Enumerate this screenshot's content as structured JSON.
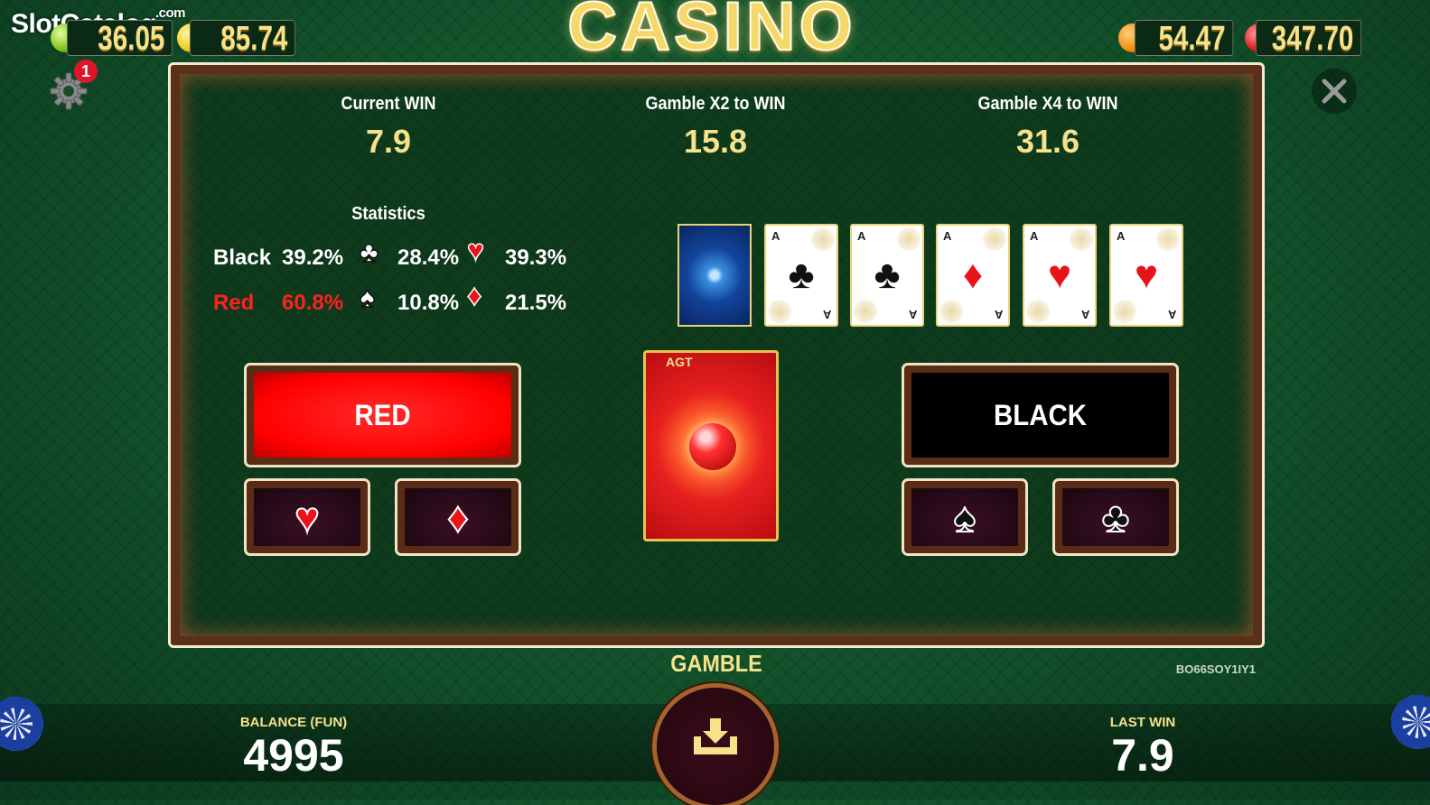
{
  "watermark": {
    "text": "SlotCatalog",
    "suffix": ".com"
  },
  "top_counters": {
    "left1": {
      "icon": "lime-icon",
      "value": "36.05"
    },
    "left2": {
      "icon": "lemon-icon",
      "value": "85.74"
    },
    "right1": {
      "icon": "orange-icon",
      "value": "54.47"
    },
    "right2": {
      "icon": "strawberry-icon",
      "value": "347.70"
    }
  },
  "title": "CASINO",
  "settings": {
    "badge": "1"
  },
  "header": {
    "current_win_label": "Current WIN",
    "current_win_value": "7.9",
    "x2_label": "Gamble X2 to WIN",
    "x2_value": "15.8",
    "x4_label": "Gamble X4 to WIN",
    "x4_value": "31.6"
  },
  "statistics": {
    "title": "Statistics",
    "black_label": "Black",
    "black_pct": "39.2%",
    "red_label": "Red",
    "red_pct": "60.8%",
    "clubs_pct": "28.4%",
    "hearts_pct": "39.3%",
    "spades_pct": "10.8%",
    "diamonds_pct": "21.5%"
  },
  "history_cards": [
    {
      "rank": "A",
      "suit": "clubs",
      "glyph": "♣",
      "color": "#111111"
    },
    {
      "rank": "A",
      "suit": "clubs",
      "glyph": "♣",
      "color": "#111111"
    },
    {
      "rank": "A",
      "suit": "diamonds",
      "glyph": "♦",
      "color": "#e8141a"
    },
    {
      "rank": "A",
      "suit": "hearts",
      "glyph": "♥",
      "color": "#e8141a"
    },
    {
      "rank": "A",
      "suit": "hearts",
      "glyph": "♥",
      "color": "#e8141a"
    }
  ],
  "card_back_logo": "AGT",
  "buttons": {
    "red": "RED",
    "black": "BLACK",
    "hearts": "♥",
    "diamonds": "♦",
    "spades": "♠",
    "clubs": "♣"
  },
  "bottom": {
    "gamble_label": "GAMBLE",
    "balance_label": "BALANCE (FUN)",
    "balance_value": "4995",
    "last_win_label": "LAST WIN",
    "last_win_value": "7.9",
    "code": "BO66SOY1IY1"
  },
  "colors": {
    "accent_gold": "#f5e28a",
    "red": "#ff1a1a",
    "panel_border": "#f3ead5"
  }
}
